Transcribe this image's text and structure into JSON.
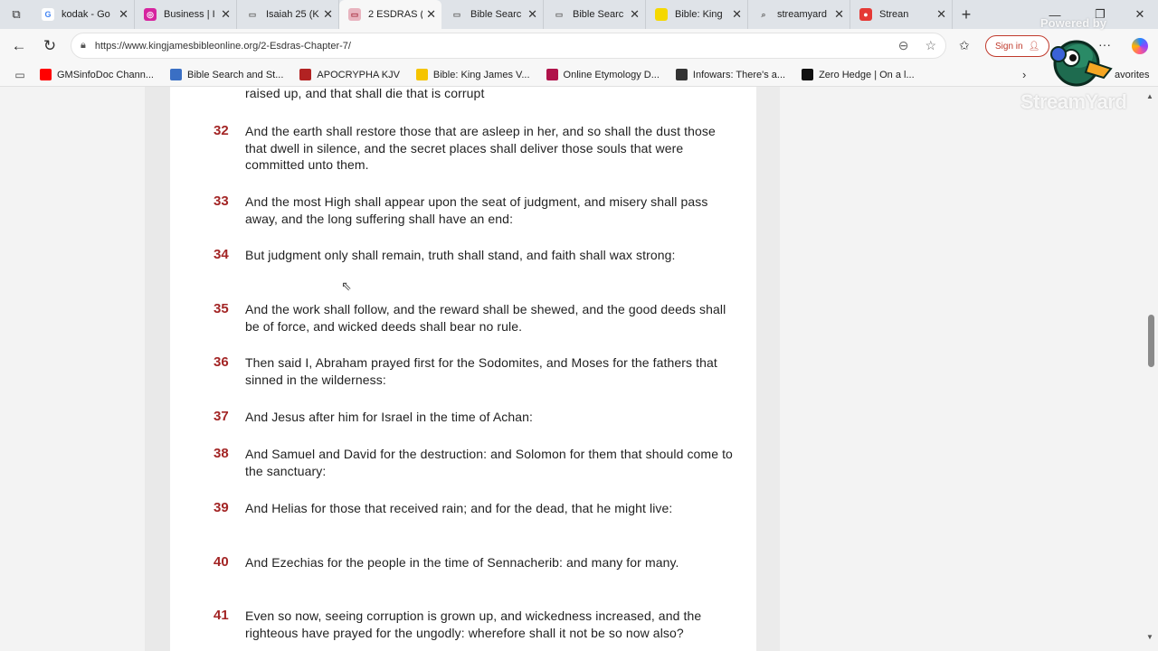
{
  "browser": {
    "tabs": [
      {
        "title": "kodak - Go",
        "favicon_color": "#ffffff",
        "favicon_glyph": "G",
        "glyph_color": "#4285f4",
        "active": false
      },
      {
        "title": "Business | I",
        "favicon_color": "#d6249f",
        "favicon_glyph": "◎",
        "glyph_color": "#ffffff",
        "active": false
      },
      {
        "title": "Isaiah 25 (K",
        "favicon_color": "#dfe3e8",
        "favicon_glyph": "▭",
        "glyph_color": "#666666",
        "active": false
      },
      {
        "title": "2 ESDRAS (",
        "favicon_color": "#e8b4bf",
        "favicon_glyph": "▭",
        "glyph_color": "#a34",
        "active": true
      },
      {
        "title": "Bible Searc",
        "favicon_color": "#dfe3e8",
        "favicon_glyph": "▭",
        "glyph_color": "#666666",
        "active": false
      },
      {
        "title": "Bible Searc",
        "favicon_color": "#dfe3e8",
        "favicon_glyph": "▭",
        "glyph_color": "#666666",
        "active": false
      },
      {
        "title": "Bible: King",
        "favicon_color": "#f5d800",
        "favicon_glyph": "",
        "glyph_color": "#ffffff",
        "active": false
      },
      {
        "title": "streamyard",
        "favicon_color": "#dfe3e8",
        "favicon_glyph": "⌕",
        "glyph_color": "#666666",
        "active": false
      },
      {
        "title": "Strean",
        "favicon_color": "#e53935",
        "favicon_glyph": "●",
        "glyph_color": "#ffffff",
        "active": false
      }
    ],
    "address": {
      "url": "https://www.kingjamesbibleonline.org/2-Esdras-Chapter-7/",
      "signin_label": "Sign in"
    },
    "bookmarks": [
      {
        "label": "GMSinfoDoc Chann...",
        "icon_color": "#ff0000"
      },
      {
        "label": "Bible Search and St...",
        "icon_color": "#3a6fc4"
      },
      {
        "label": "APOCRYPHA KJV",
        "icon_color": "#b22222"
      },
      {
        "label": "Bible: King James V...",
        "icon_color": "#f5c400"
      },
      {
        "label": "Online Etymology D...",
        "icon_color": "#b0124a"
      },
      {
        "label": "Infowars: There's a...",
        "icon_color": "#333333"
      },
      {
        "label": "Zero Hedge | On a l...",
        "icon_color": "#111111"
      }
    ],
    "favorites_label": "avorites"
  },
  "page": {
    "lead_in": "raised up, and that shall die that is corrupt",
    "verses": [
      {
        "num": "32",
        "text": "And the earth shall restore those that are asleep in her, and so shall the dust those that dwell in silence, and the secret places shall deliver those souls that were committed unto them."
      },
      {
        "num": "33",
        "text": "And the most High shall appear upon the seat of judgment, and misery shall pass away, and the long suffering shall have an end:"
      },
      {
        "num": "34",
        "text": "But judgment only shall remain, truth shall stand, and faith shall wax strong:"
      },
      {
        "num": "35",
        "text": "And the work shall follow, and the reward shall be shewed, and the good deeds shall be of force, and wicked deeds shall bear no rule."
      },
      {
        "num": "36",
        "text": "Then said I, Abraham prayed first for the Sodomites, and Moses for the fathers that sinned in the wilderness:"
      },
      {
        "num": "37",
        "text": "And Jesus after him for Israel in the time of Achan:"
      },
      {
        "num": "38",
        "text": "And Samuel and David for the destruction: and Solomon for them that should come to the sanctuary:"
      },
      {
        "num": "39",
        "text": "And Helias for those that received rain; and for the dead, that he might live:"
      },
      {
        "num": "40",
        "text": "And Ezechias for the people in the time of Sennacherib: and many for many."
      },
      {
        "num": "41",
        "text": "Even so now, seeing corruption is grown up, and wickedness increased, and the righteous have prayed for the ungodly: wherefore shall it not be so now also?"
      }
    ]
  },
  "overlay": {
    "powered_by": "Powered by",
    "brand": "StreamYard"
  }
}
